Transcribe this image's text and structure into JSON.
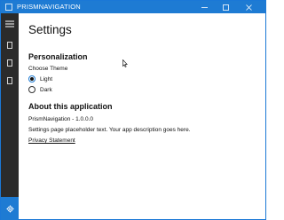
{
  "window": {
    "title": "PRISMNAVIGATION",
    "accent_color": "#1e7bd3",
    "sidebar_color": "#2b2b2b",
    "controls": [
      "minimize-icon",
      "maximize-icon",
      "close-icon"
    ]
  },
  "sidebar": {
    "items": [
      {
        "icon": "hamburger-menu-icon"
      },
      {
        "icon": "page-icon"
      },
      {
        "icon": "page-icon"
      },
      {
        "icon": "page-icon"
      },
      {
        "icon": "gear-icon",
        "selected": true
      }
    ]
  },
  "page": {
    "title": "Settings",
    "personalization": {
      "heading": "Personalization",
      "choose_theme_label": "Choose Theme",
      "options": [
        {
          "label": "Light",
          "checked": true
        },
        {
          "label": "Dark",
          "checked": false
        }
      ]
    },
    "about": {
      "heading": "About this application",
      "version": "PrismNavigation - 1.0.0.0",
      "description": "Settings page placeholder text.  Your app description goes here.",
      "privacy_link": "Privacy Statement"
    }
  }
}
